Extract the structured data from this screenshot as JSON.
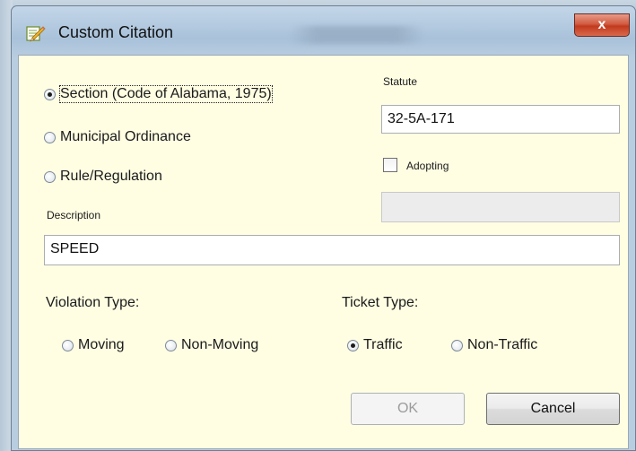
{
  "window": {
    "title": "Custom Citation",
    "close_glyph": "x",
    "title_icon": "pencil-icon"
  },
  "citation_type": {
    "options": [
      {
        "label": "Section (Code of Alabama, 1975)",
        "checked": true
      },
      {
        "label": "Municipal Ordinance",
        "checked": false
      },
      {
        "label": "Rule/Regulation",
        "checked": false
      }
    ]
  },
  "statute": {
    "label": "Statute",
    "value": "32-5A-171"
  },
  "adopting": {
    "label": "Adopting",
    "checked": false,
    "value": ""
  },
  "description": {
    "label": "Description",
    "value": "SPEED"
  },
  "violation_type": {
    "label": "Violation Type:",
    "options": [
      {
        "label": "Moving",
        "checked": false
      },
      {
        "label": "Non-Moving",
        "checked": false
      }
    ]
  },
  "ticket_type": {
    "label": "Ticket Type:",
    "options": [
      {
        "label": "Traffic",
        "checked": true
      },
      {
        "label": "Non-Traffic",
        "checked": false
      }
    ]
  },
  "buttons": {
    "ok": "OK",
    "cancel": "Cancel"
  },
  "colors": {
    "client_background": "#fffee3",
    "close_button": "#c23a1e"
  }
}
